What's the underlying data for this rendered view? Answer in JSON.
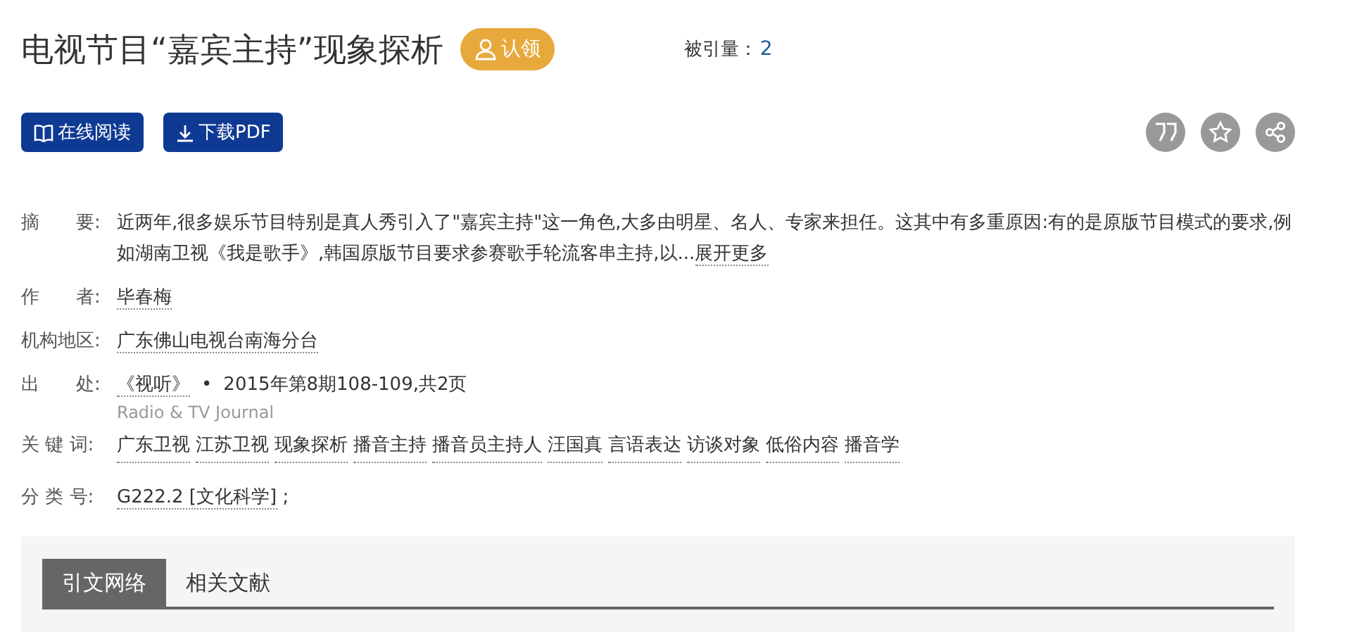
{
  "title": "电视节目“嘉宾主持”现象探析",
  "claim_button": "认领",
  "citations": {
    "label": "被引量：",
    "value": "2"
  },
  "actions": [
    {
      "kind": "read",
      "label": "在线阅读"
    },
    {
      "kind": "download",
      "label": "下载PDF"
    }
  ],
  "tools": [
    {
      "kind": "quote"
    },
    {
      "kind": "star"
    },
    {
      "kind": "share"
    }
  ],
  "abstract": {
    "label": "摘　　要:",
    "text": "近两年,很多娱乐节目特别是真人秀引入了\"嘉宾主持\"这一角色,大多由明星、名人、专家来担任。这其中有多重原因:有的是原版节目模式的要求,例如湖南卫视《我是歌手》,韩国原版节目要求参赛歌手轮流客串主持,以...",
    "more": "展开更多"
  },
  "author": {
    "label": "作　　者:",
    "value": "毕春梅"
  },
  "institution": {
    "label": "机构地区:",
    "value": "广东佛山电视台南海分台"
  },
  "source": {
    "label": "出　　处:",
    "journal": "《视听》",
    "separator": "•",
    "issue": "2015年第8期108-109,共2页",
    "journal_en": "Radio & TV Journal"
  },
  "keywords": {
    "label": "关 键 词:",
    "items": [
      "广东卫视",
      "江苏卫视",
      "现象探析",
      "播音主持",
      "播音员主持人",
      "汪国真",
      "言语表达",
      "访谈对象",
      "低俗内容",
      "播音学"
    ]
  },
  "classification": {
    "label": "分 类 号:",
    "value": "G222.2 [文化科学]",
    "suffix": ";"
  },
  "tabs": [
    {
      "label": "引文网络",
      "selected": true
    },
    {
      "label": "相关文献",
      "selected": false
    }
  ]
}
